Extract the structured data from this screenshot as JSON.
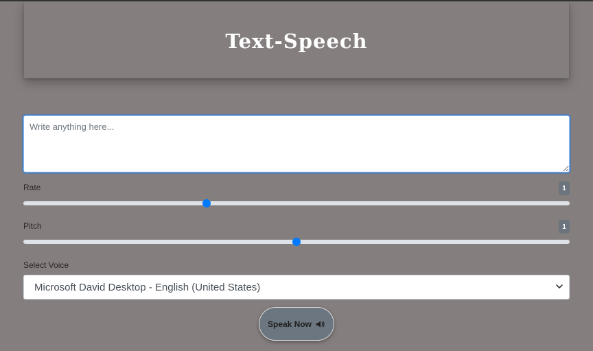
{
  "header": {
    "title": "Text-Speech"
  },
  "text_input": {
    "placeholder": "Write anything here...",
    "value": ""
  },
  "rate": {
    "label": "Rate",
    "value": "1",
    "slider_fraction": 0.336
  },
  "pitch": {
    "label": "Pitch",
    "value": "1",
    "slider_fraction": 0.5
  },
  "voice": {
    "label": "Select Voice",
    "selected": "Microsoft David Desktop - English (United States)"
  },
  "speak_button": {
    "label": "Speak Now",
    "icon": "speaker-icon"
  },
  "colors": {
    "background": "#857e7e",
    "accent": "#007bff",
    "badge": "#6c757d",
    "button": "#6c7680"
  }
}
